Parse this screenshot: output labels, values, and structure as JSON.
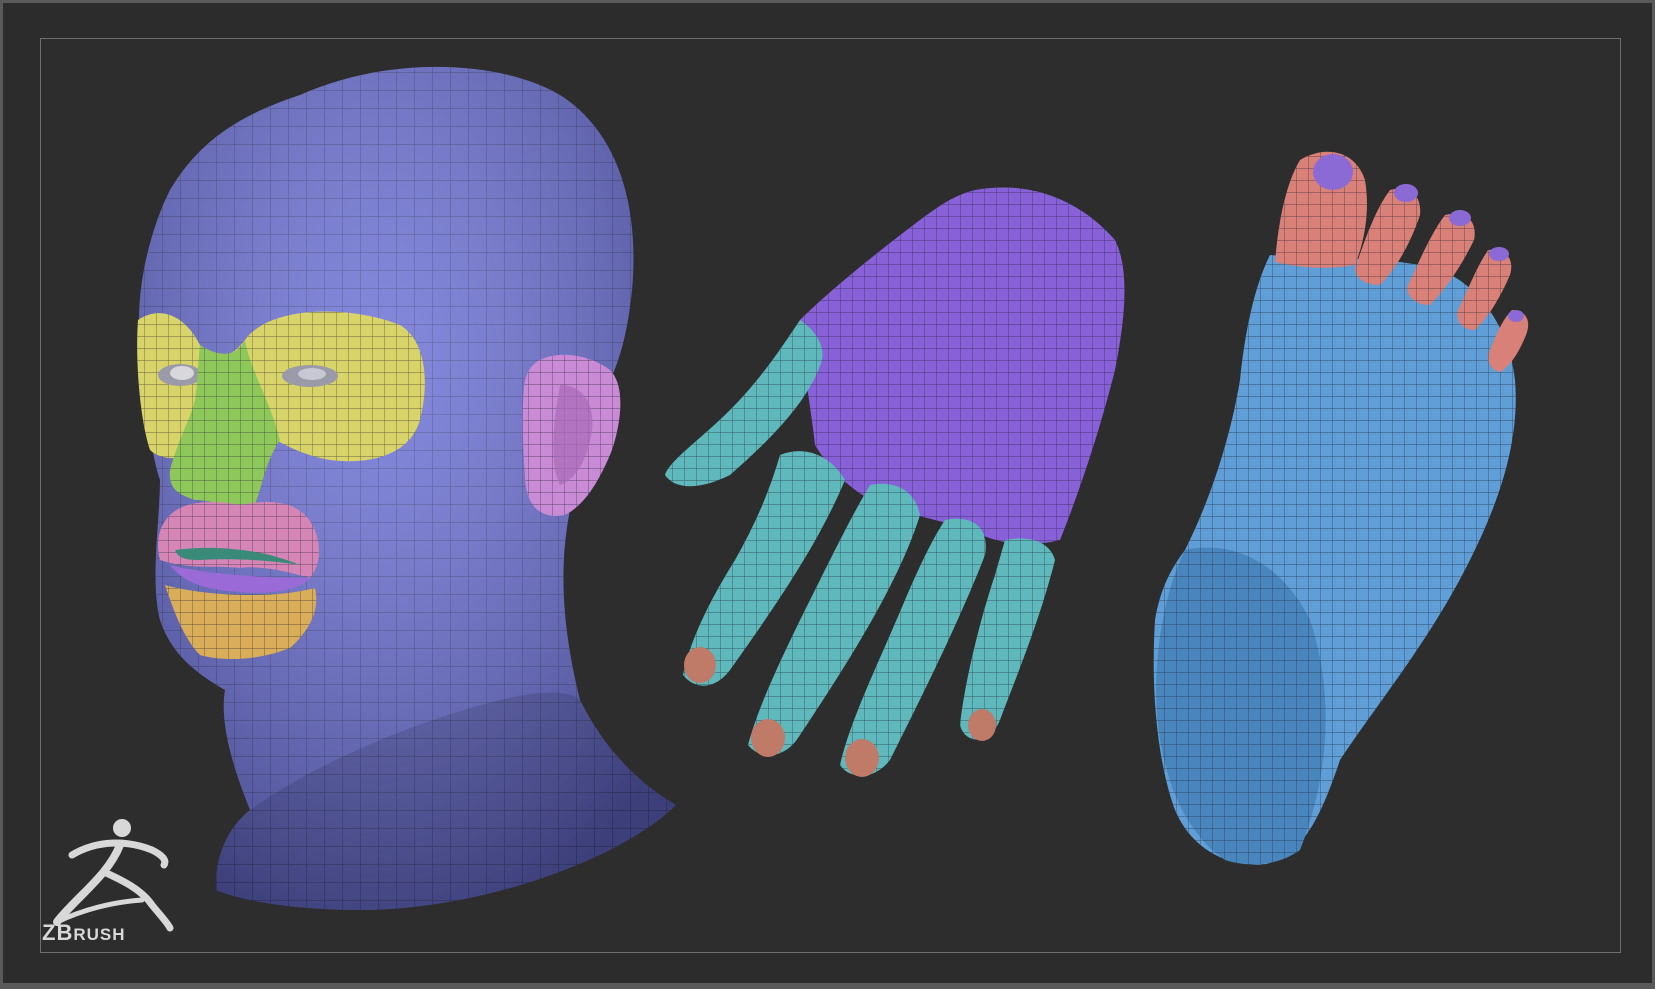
{
  "brand": {
    "logo_icon": "zbrush-runner-icon",
    "name_prefix": "ZB",
    "name_suffix": "RUSH"
  },
  "colors": {
    "background": "#2d2d2d",
    "head": "#6a6fd6",
    "eye_region": "#d9d46a",
    "nose": "#8fc85a",
    "lips": "#d586b6",
    "chin": "#d9ad5a",
    "ear": "#c98ad6",
    "hand_back": "#8860d8",
    "fingers": "#5fb8bb",
    "nails": "#c07a68",
    "foot": "#5f9ed6",
    "toes": "#d98078",
    "toenails": "#8c6ad6"
  }
}
